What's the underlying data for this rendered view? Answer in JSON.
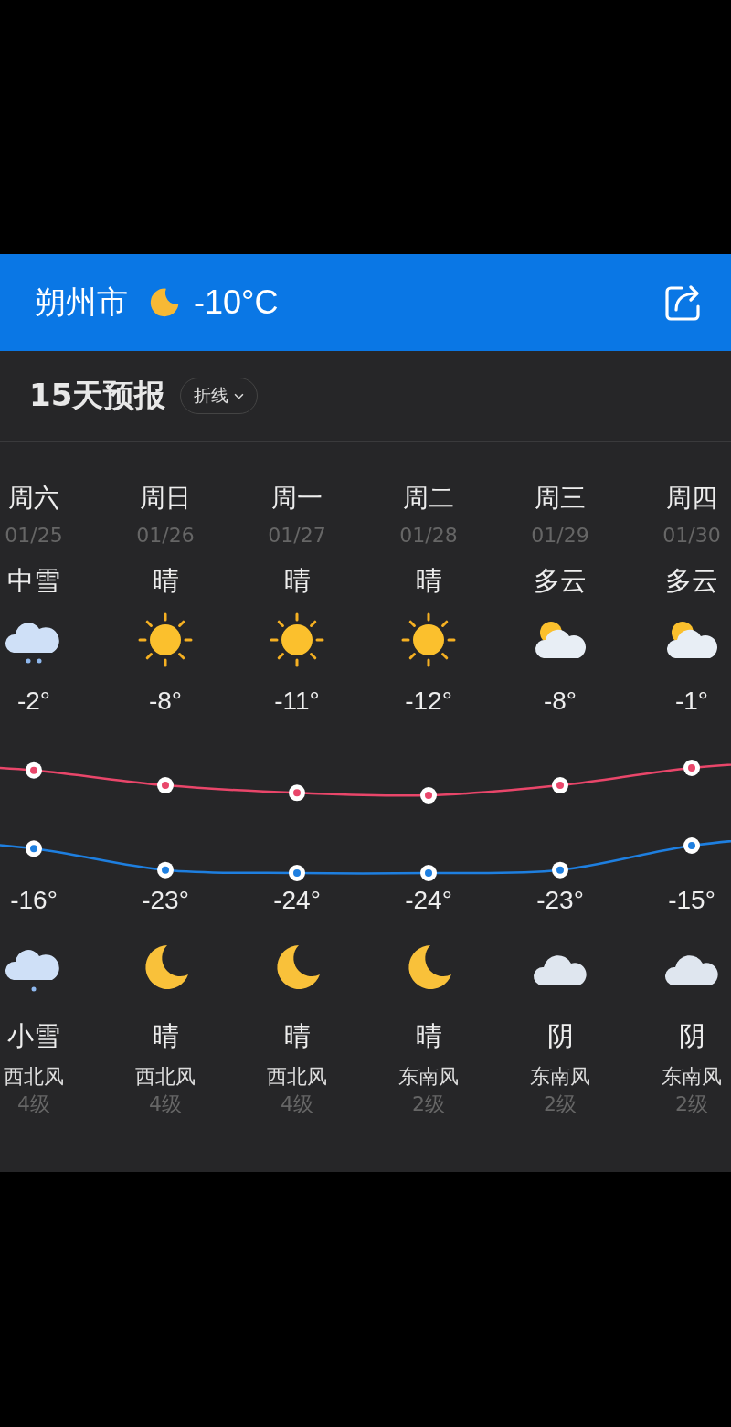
{
  "header": {
    "city": "朔州市",
    "icon": {
      "kind": "moon"
    },
    "temperature": "-10°C"
  },
  "forecast": {
    "title": "15天预报",
    "mode_button": "折线",
    "days": [
      {
        "weekday": "周六",
        "date": "01/25",
        "day_condition": "中雪",
        "day_icon": {
          "kind": "snow"
        },
        "high": "-2°",
        "low": "-16°",
        "night_icon": {
          "kind": "light-snow"
        },
        "night_condition": "小雪",
        "wind": "西北风",
        "wind_level": "4级"
      },
      {
        "weekday": "周日",
        "date": "01/26",
        "day_condition": "晴",
        "day_icon": {
          "kind": "sun"
        },
        "high": "-8°",
        "low": "-23°",
        "night_icon": {
          "kind": "moon"
        },
        "night_condition": "晴",
        "wind": "西北风",
        "wind_level": "4级"
      },
      {
        "weekday": "周一",
        "date": "01/27",
        "day_condition": "晴",
        "day_icon": {
          "kind": "sun"
        },
        "high": "-11°",
        "low": "-24°",
        "night_icon": {
          "kind": "moon"
        },
        "night_condition": "晴",
        "wind": "西北风",
        "wind_level": "4级"
      },
      {
        "weekday": "周二",
        "date": "01/28",
        "day_condition": "晴",
        "day_icon": {
          "kind": "sun"
        },
        "high": "-12°",
        "low": "-24°",
        "night_icon": {
          "kind": "moon"
        },
        "night_condition": "晴",
        "wind": "东南风",
        "wind_level": "2级"
      },
      {
        "weekday": "周三",
        "date": "01/29",
        "day_condition": "多云",
        "day_icon": {
          "kind": "partly-cloudy"
        },
        "high": "-8°",
        "low": "-23°",
        "night_icon": {
          "kind": "cloud"
        },
        "night_condition": "阴",
        "wind": "东南风",
        "wind_level": "2级"
      },
      {
        "weekday": "周四",
        "date": "01/30",
        "day_condition": "多云",
        "day_icon": {
          "kind": "partly-cloudy"
        },
        "high": "-1°",
        "low": "-15°",
        "night_icon": {
          "kind": "cloud"
        },
        "night_condition": "阴",
        "wind": "东南风",
        "wind_level": "2级"
      }
    ]
  }
}
